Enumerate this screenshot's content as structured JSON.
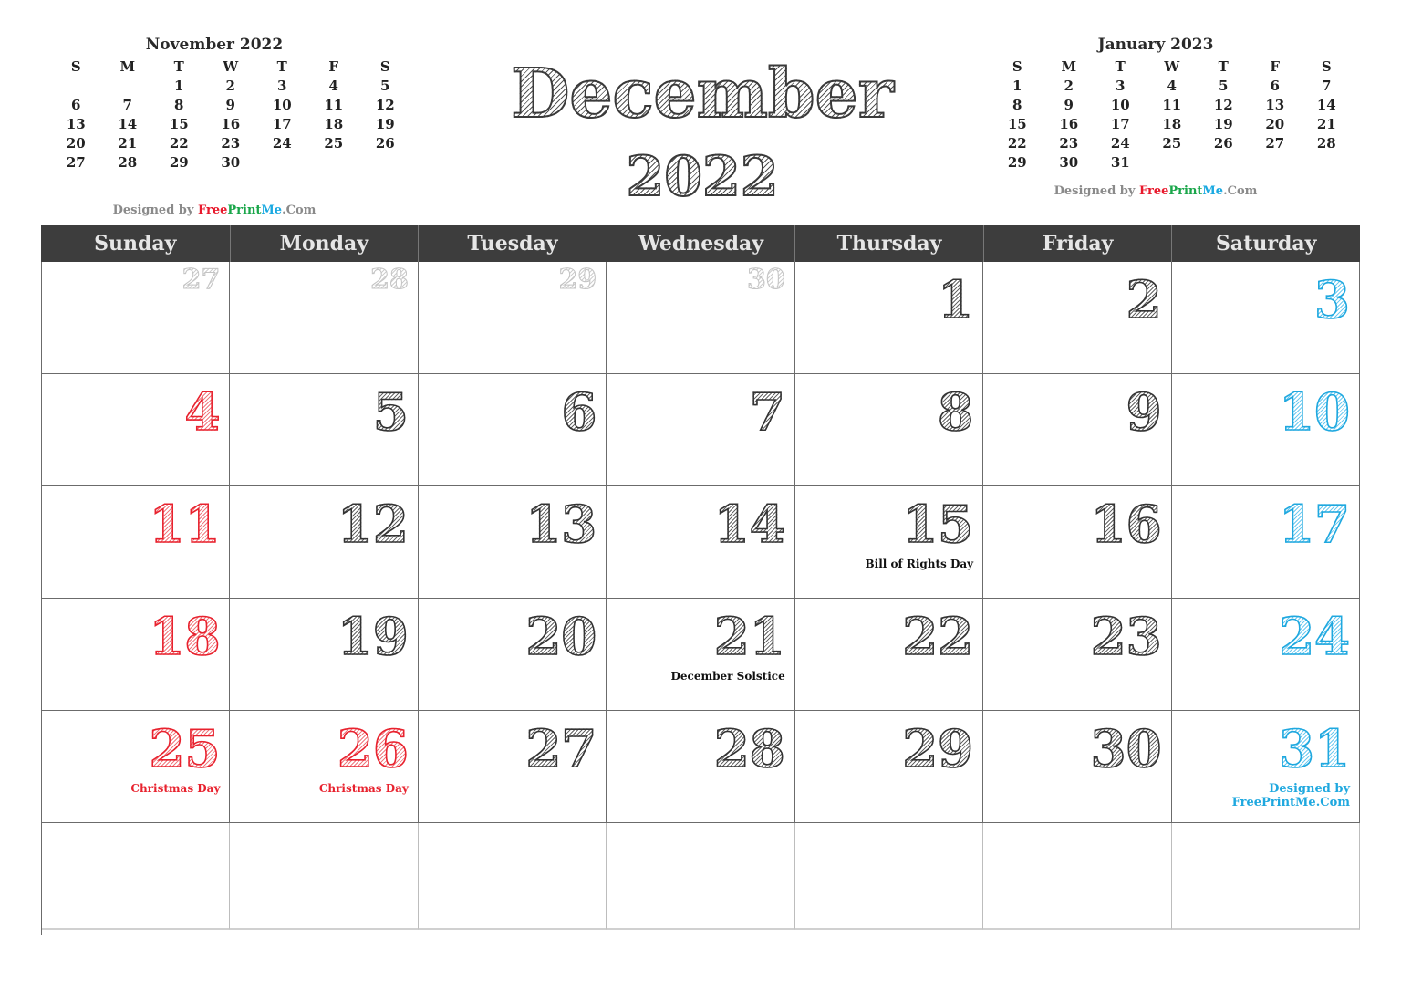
{
  "title": {
    "month": "December",
    "year": "2022"
  },
  "prev_month": {
    "title": "November 2022",
    "weekday_headers": [
      "S",
      "M",
      "T",
      "W",
      "T",
      "F",
      "S"
    ],
    "days": [
      "",
      "",
      "1",
      "2",
      "3",
      "4",
      "5",
      "6",
      "7",
      "8",
      "9",
      "10",
      "11",
      "12",
      "13",
      "14",
      "15",
      "16",
      "17",
      "18",
      "19",
      "20",
      "21",
      "22",
      "23",
      "24",
      "25",
      "26",
      "27",
      "28",
      "29",
      "30",
      "",
      "",
      "",
      "",
      ""
    ]
  },
  "next_month": {
    "title": "January 2023",
    "weekday_headers": [
      "S",
      "M",
      "T",
      "W",
      "T",
      "F",
      "S"
    ],
    "days": [
      "1",
      "2",
      "3",
      "4",
      "5",
      "6",
      "7",
      "8",
      "9",
      "10",
      "11",
      "12",
      "13",
      "14",
      "15",
      "16",
      "17",
      "18",
      "19",
      "20",
      "21",
      "22",
      "23",
      "24",
      "25",
      "26",
      "27",
      "28",
      "29",
      "30",
      "31",
      "",
      "",
      "",
      ""
    ]
  },
  "credit": {
    "prefix": "Designed by ",
    "free": "Free",
    "print": "Print",
    "me": "Me",
    "com": ".Com"
  },
  "colors": {
    "header_bg": "#3d3d3d",
    "weekend_sunday": "#e8222e",
    "weekend_saturday": "#1fa8df",
    "brand_free": "#e8192c",
    "brand_print": "#1aa64a",
    "brand_me": "#1aa9e1"
  },
  "weekdays": [
    "Sunday",
    "Monday",
    "Tuesday",
    "Wednesday",
    "Thursday",
    "Friday",
    "Saturday"
  ],
  "weeks": [
    [
      {
        "day": "27",
        "type": "prev"
      },
      {
        "day": "28",
        "type": "prev"
      },
      {
        "day": "29",
        "type": "prev"
      },
      {
        "day": "30",
        "type": "prev"
      },
      {
        "day": "1"
      },
      {
        "day": "2"
      },
      {
        "day": "3",
        "type": "blue"
      }
    ],
    [
      {
        "day": "4",
        "type": "red"
      },
      {
        "day": "5"
      },
      {
        "day": "6"
      },
      {
        "day": "7"
      },
      {
        "day": "8"
      },
      {
        "day": "9"
      },
      {
        "day": "10",
        "type": "blue"
      }
    ],
    [
      {
        "day": "11",
        "type": "red"
      },
      {
        "day": "12"
      },
      {
        "day": "13"
      },
      {
        "day": "14"
      },
      {
        "day": "15",
        "note": "Bill of Rights Day"
      },
      {
        "day": "16"
      },
      {
        "day": "17",
        "type": "blue"
      }
    ],
    [
      {
        "day": "18",
        "type": "red"
      },
      {
        "day": "19"
      },
      {
        "day": "20"
      },
      {
        "day": "21",
        "note": "December Solstice"
      },
      {
        "day": "22"
      },
      {
        "day": "23"
      },
      {
        "day": "24",
        "type": "blue"
      }
    ],
    [
      {
        "day": "25",
        "type": "red",
        "note": "Christmas Day"
      },
      {
        "day": "26",
        "type": "red",
        "note": "Christmas Day"
      },
      {
        "day": "27"
      },
      {
        "day": "28"
      },
      {
        "day": "29"
      },
      {
        "day": "30"
      },
      {
        "day": "31",
        "type": "blue",
        "note": "Designed by\nFreePrintMe.Com"
      }
    ],
    [
      {},
      {},
      {},
      {},
      {},
      {},
      {}
    ]
  ]
}
